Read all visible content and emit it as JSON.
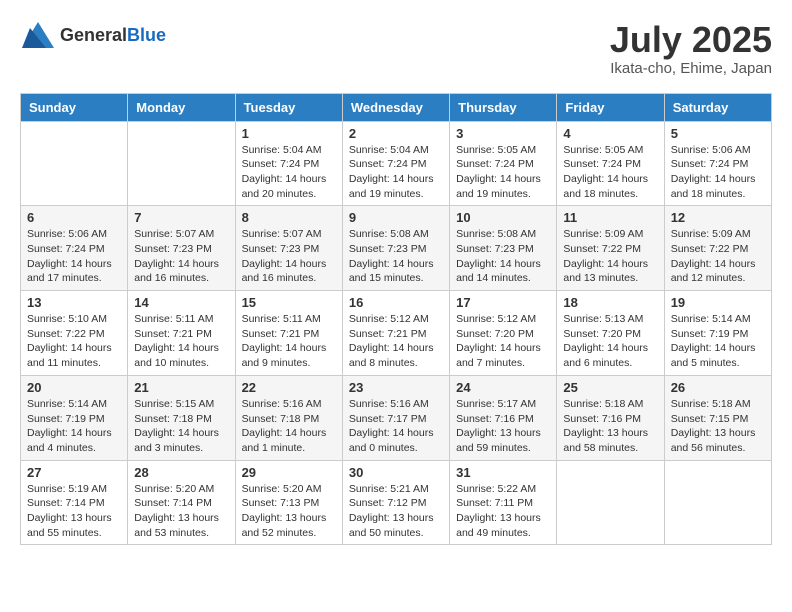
{
  "header": {
    "logo_general": "General",
    "logo_blue": "Blue",
    "month": "July 2025",
    "location": "Ikata-cho, Ehime, Japan"
  },
  "days_of_week": [
    "Sunday",
    "Monday",
    "Tuesday",
    "Wednesday",
    "Thursday",
    "Friday",
    "Saturday"
  ],
  "weeks": [
    [
      {
        "day": "",
        "sunrise": "",
        "sunset": "",
        "daylight": ""
      },
      {
        "day": "",
        "sunrise": "",
        "sunset": "",
        "daylight": ""
      },
      {
        "day": "1",
        "sunrise": "Sunrise: 5:04 AM",
        "sunset": "Sunset: 7:24 PM",
        "daylight": "Daylight: 14 hours and 20 minutes."
      },
      {
        "day": "2",
        "sunrise": "Sunrise: 5:04 AM",
        "sunset": "Sunset: 7:24 PM",
        "daylight": "Daylight: 14 hours and 19 minutes."
      },
      {
        "day": "3",
        "sunrise": "Sunrise: 5:05 AM",
        "sunset": "Sunset: 7:24 PM",
        "daylight": "Daylight: 14 hours and 19 minutes."
      },
      {
        "day": "4",
        "sunrise": "Sunrise: 5:05 AM",
        "sunset": "Sunset: 7:24 PM",
        "daylight": "Daylight: 14 hours and 18 minutes."
      },
      {
        "day": "5",
        "sunrise": "Sunrise: 5:06 AM",
        "sunset": "Sunset: 7:24 PM",
        "daylight": "Daylight: 14 hours and 18 minutes."
      }
    ],
    [
      {
        "day": "6",
        "sunrise": "Sunrise: 5:06 AM",
        "sunset": "Sunset: 7:24 PM",
        "daylight": "Daylight: 14 hours and 17 minutes."
      },
      {
        "day": "7",
        "sunrise": "Sunrise: 5:07 AM",
        "sunset": "Sunset: 7:23 PM",
        "daylight": "Daylight: 14 hours and 16 minutes."
      },
      {
        "day": "8",
        "sunrise": "Sunrise: 5:07 AM",
        "sunset": "Sunset: 7:23 PM",
        "daylight": "Daylight: 14 hours and 16 minutes."
      },
      {
        "day": "9",
        "sunrise": "Sunrise: 5:08 AM",
        "sunset": "Sunset: 7:23 PM",
        "daylight": "Daylight: 14 hours and 15 minutes."
      },
      {
        "day": "10",
        "sunrise": "Sunrise: 5:08 AM",
        "sunset": "Sunset: 7:23 PM",
        "daylight": "Daylight: 14 hours and 14 minutes."
      },
      {
        "day": "11",
        "sunrise": "Sunrise: 5:09 AM",
        "sunset": "Sunset: 7:22 PM",
        "daylight": "Daylight: 14 hours and 13 minutes."
      },
      {
        "day": "12",
        "sunrise": "Sunrise: 5:09 AM",
        "sunset": "Sunset: 7:22 PM",
        "daylight": "Daylight: 14 hours and 12 minutes."
      }
    ],
    [
      {
        "day": "13",
        "sunrise": "Sunrise: 5:10 AM",
        "sunset": "Sunset: 7:22 PM",
        "daylight": "Daylight: 14 hours and 11 minutes."
      },
      {
        "day": "14",
        "sunrise": "Sunrise: 5:11 AM",
        "sunset": "Sunset: 7:21 PM",
        "daylight": "Daylight: 14 hours and 10 minutes."
      },
      {
        "day": "15",
        "sunrise": "Sunrise: 5:11 AM",
        "sunset": "Sunset: 7:21 PM",
        "daylight": "Daylight: 14 hours and 9 minutes."
      },
      {
        "day": "16",
        "sunrise": "Sunrise: 5:12 AM",
        "sunset": "Sunset: 7:21 PM",
        "daylight": "Daylight: 14 hours and 8 minutes."
      },
      {
        "day": "17",
        "sunrise": "Sunrise: 5:12 AM",
        "sunset": "Sunset: 7:20 PM",
        "daylight": "Daylight: 14 hours and 7 minutes."
      },
      {
        "day": "18",
        "sunrise": "Sunrise: 5:13 AM",
        "sunset": "Sunset: 7:20 PM",
        "daylight": "Daylight: 14 hours and 6 minutes."
      },
      {
        "day": "19",
        "sunrise": "Sunrise: 5:14 AM",
        "sunset": "Sunset: 7:19 PM",
        "daylight": "Daylight: 14 hours and 5 minutes."
      }
    ],
    [
      {
        "day": "20",
        "sunrise": "Sunrise: 5:14 AM",
        "sunset": "Sunset: 7:19 PM",
        "daylight": "Daylight: 14 hours and 4 minutes."
      },
      {
        "day": "21",
        "sunrise": "Sunrise: 5:15 AM",
        "sunset": "Sunset: 7:18 PM",
        "daylight": "Daylight: 14 hours and 3 minutes."
      },
      {
        "day": "22",
        "sunrise": "Sunrise: 5:16 AM",
        "sunset": "Sunset: 7:18 PM",
        "daylight": "Daylight: 14 hours and 1 minute."
      },
      {
        "day": "23",
        "sunrise": "Sunrise: 5:16 AM",
        "sunset": "Sunset: 7:17 PM",
        "daylight": "Daylight: 14 hours and 0 minutes."
      },
      {
        "day": "24",
        "sunrise": "Sunrise: 5:17 AM",
        "sunset": "Sunset: 7:16 PM",
        "daylight": "Daylight: 13 hours and 59 minutes."
      },
      {
        "day": "25",
        "sunrise": "Sunrise: 5:18 AM",
        "sunset": "Sunset: 7:16 PM",
        "daylight": "Daylight: 13 hours and 58 minutes."
      },
      {
        "day": "26",
        "sunrise": "Sunrise: 5:18 AM",
        "sunset": "Sunset: 7:15 PM",
        "daylight": "Daylight: 13 hours and 56 minutes."
      }
    ],
    [
      {
        "day": "27",
        "sunrise": "Sunrise: 5:19 AM",
        "sunset": "Sunset: 7:14 PM",
        "daylight": "Daylight: 13 hours and 55 minutes."
      },
      {
        "day": "28",
        "sunrise": "Sunrise: 5:20 AM",
        "sunset": "Sunset: 7:14 PM",
        "daylight": "Daylight: 13 hours and 53 minutes."
      },
      {
        "day": "29",
        "sunrise": "Sunrise: 5:20 AM",
        "sunset": "Sunset: 7:13 PM",
        "daylight": "Daylight: 13 hours and 52 minutes."
      },
      {
        "day": "30",
        "sunrise": "Sunrise: 5:21 AM",
        "sunset": "Sunset: 7:12 PM",
        "daylight": "Daylight: 13 hours and 50 minutes."
      },
      {
        "day": "31",
        "sunrise": "Sunrise: 5:22 AM",
        "sunset": "Sunset: 7:11 PM",
        "daylight": "Daylight: 13 hours and 49 minutes."
      },
      {
        "day": "",
        "sunrise": "",
        "sunset": "",
        "daylight": ""
      },
      {
        "day": "",
        "sunrise": "",
        "sunset": "",
        "daylight": ""
      }
    ]
  ]
}
